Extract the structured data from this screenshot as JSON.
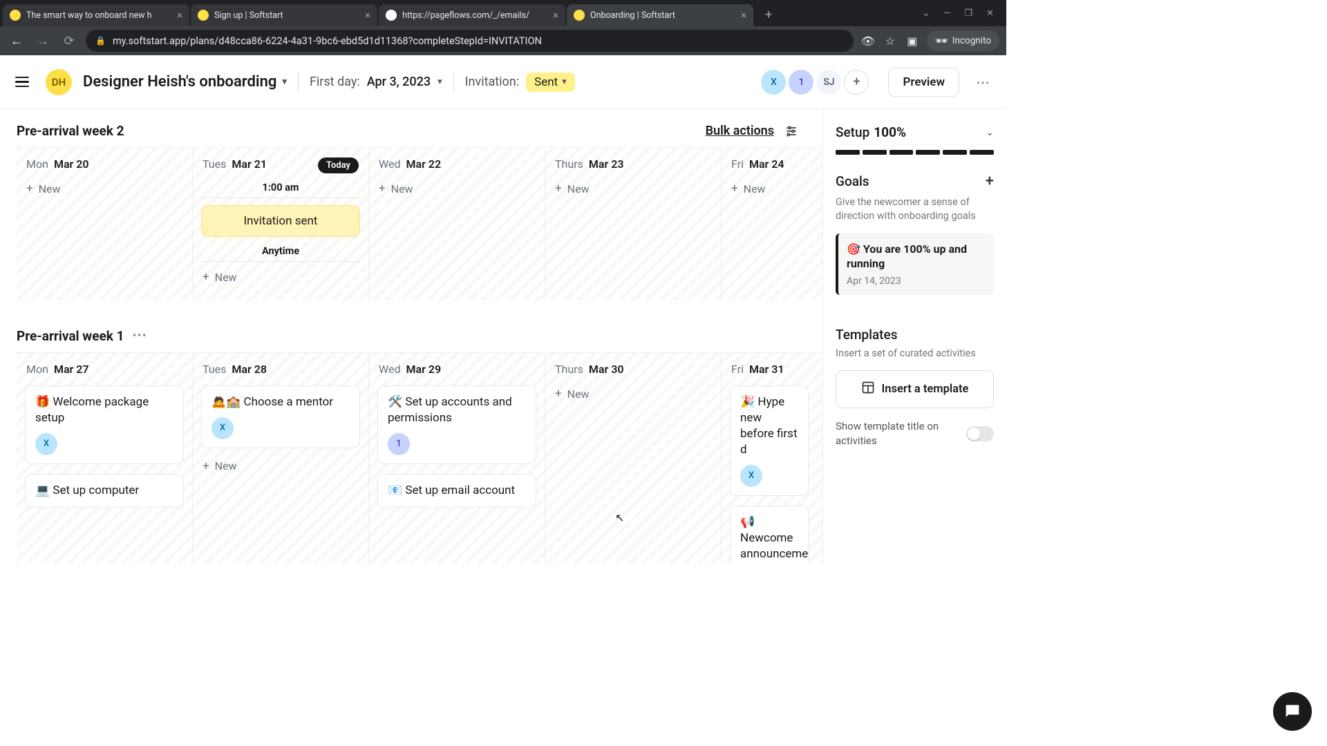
{
  "browser": {
    "tabs": [
      {
        "title": "The smart way to onboard new h"
      },
      {
        "title": "Sign up | Softstart"
      },
      {
        "title": "https://pageflows.com/_/emails/"
      },
      {
        "title": "Onboarding | Softstart"
      }
    ],
    "url": "my.softstart.app/plans/d48cca86-6224-4a31-9bc6-ebd5d1d11368?completeStepId=INVITATION",
    "incognito": "Incognito"
  },
  "header": {
    "avatar_initials": "DH",
    "plan_title": "Designer Heish's onboarding",
    "first_day_label": "First day:",
    "first_day_value": "Apr 3, 2023",
    "invitation_label": "Invitation:",
    "invitation_value": "Sent",
    "avatars": {
      "a": "X",
      "b": "1",
      "c": "SJ"
    },
    "preview": "Preview"
  },
  "week2": {
    "title": "Pre-arrival week 2",
    "bulk": "Bulk actions",
    "days": [
      {
        "dow": "Mon",
        "date": "Mar 20"
      },
      {
        "dow": "Tues",
        "date": "Mar 21",
        "today": "Today",
        "time": "1:00 am",
        "event": "Invitation sent",
        "anytime": "Anytime"
      },
      {
        "dow": "Wed",
        "date": "Mar 22"
      },
      {
        "dow": "Thurs",
        "date": "Mar 23"
      },
      {
        "dow": "Fri",
        "date": "Mar 24"
      }
    ],
    "new": "New"
  },
  "week1": {
    "title": "Pre-arrival week 1",
    "days": [
      {
        "dow": "Mon",
        "date": "Mar 27",
        "tasks": [
          {
            "text": "🎁 Welcome package setup",
            "av": "X",
            "avc": "av-x"
          },
          {
            "text": "💻 Set up computer"
          }
        ]
      },
      {
        "dow": "Tues",
        "date": "Mar 28",
        "tasks": [
          {
            "text": "🙇🏫 Choose a mentor",
            "av": "X",
            "avc": "av-x"
          }
        ],
        "shownew": true
      },
      {
        "dow": "Wed",
        "date": "Mar 29",
        "tasks": [
          {
            "text": "🛠️ Set up accounts and permissions",
            "av": "1",
            "avc": "av-1"
          },
          {
            "text": "📧 Set up email account"
          }
        ]
      },
      {
        "dow": "Thurs",
        "date": "Mar 30",
        "tasks": [],
        "shownew": true
      },
      {
        "dow": "Fri",
        "date": "Mar 31",
        "tasks": [
          {
            "text": "🎉 Hype new before first d",
            "av": "X",
            "avc": "av-x"
          },
          {
            "text": "📢 Newcome announceme"
          }
        ]
      }
    ],
    "new": "New"
  },
  "side": {
    "setup_label": "Setup",
    "setup_pct": "100%",
    "goals_title": "Goals",
    "goals_desc": "Give the newcomer a sense of direction with onboarding goals",
    "goal_icon": "🎯",
    "goal_text": "You are 100% up and running",
    "goal_date": "Apr 14, 2023",
    "templates_title": "Templates",
    "templates_desc": "Insert a set of curated activities",
    "insert_label": "Insert a template",
    "toggle_label": "Show template title on activities"
  }
}
